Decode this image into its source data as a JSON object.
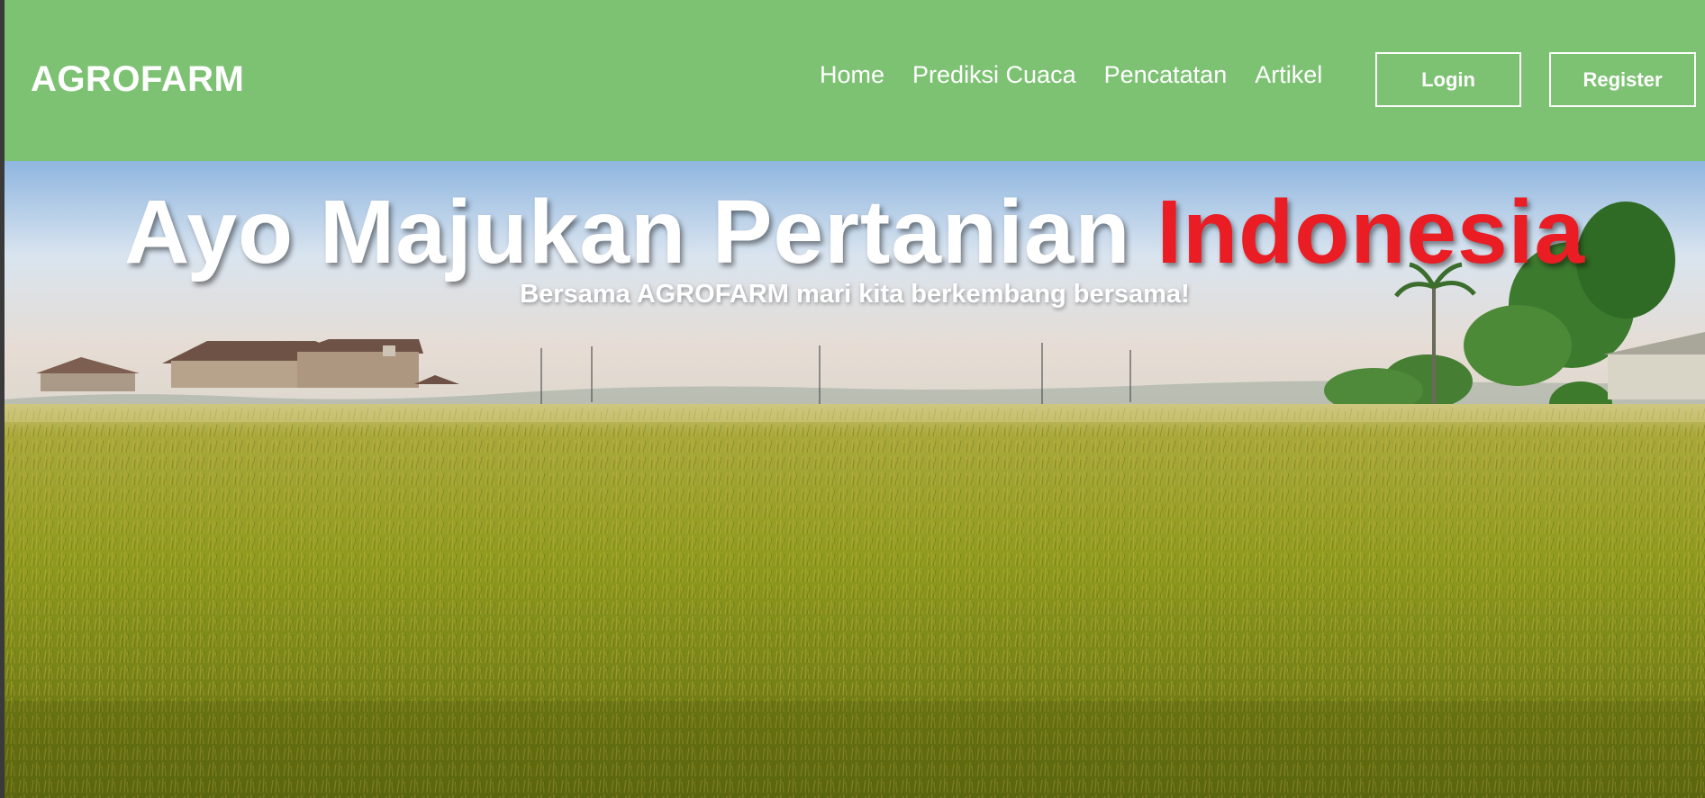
{
  "navbar": {
    "brand": "AGROFARM",
    "links": [
      "Home",
      "Prediksi Cuaca",
      "Pencatatan",
      "Artikel"
    ],
    "login_label": "Login",
    "register_label": "Register"
  },
  "hero": {
    "title_main": "Ayo Majukan Pertanian ",
    "title_accent": "Indonesia",
    "subtitle": "Bersama AGROFARM mari kita berkembang bersama!",
    "accent_color": "#ea1c24"
  },
  "colors": {
    "navbar_bg": "#7dc273",
    "text": "#ffffff"
  }
}
